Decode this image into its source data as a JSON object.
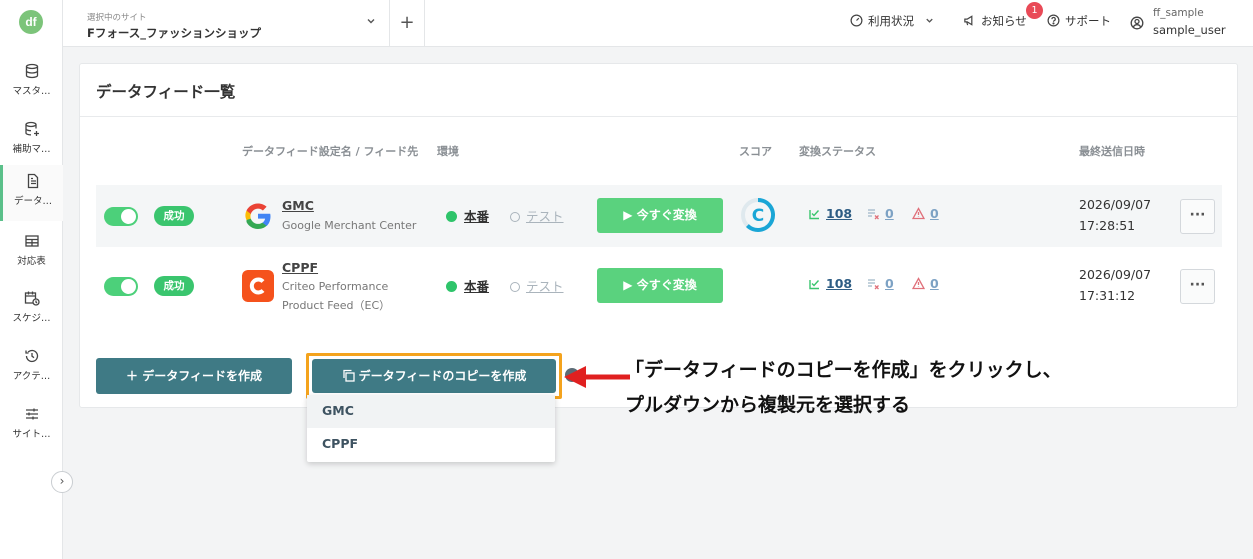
{
  "sidebar": {
    "logo": "df",
    "items": [
      {
        "label": "マスタ…",
        "icon": "database-icon"
      },
      {
        "label": "補助マ…",
        "icon": "database-add-icon"
      },
      {
        "label": "データ…",
        "icon": "document-icon"
      },
      {
        "label": "対応表",
        "icon": "table-icon"
      },
      {
        "label": "スケジ…",
        "icon": "calendar-clock-icon"
      },
      {
        "label": "アクテ…",
        "icon": "history-icon"
      },
      {
        "label": "サイト…",
        "icon": "sliders-icon"
      }
    ],
    "expand": "›"
  },
  "header": {
    "site_label": "選択中のサイト",
    "site_name": "Fフォース_ファッションショップ",
    "usage": "利用状況",
    "news": "お知らせ",
    "news_badge": "1",
    "support": "サポート",
    "user_id": "ff_sample",
    "user_name": "sample_user"
  },
  "main": {
    "title": "データフィード一覧",
    "columns": {
      "name": "データフィード設定名 / フィード先",
      "env": "環境",
      "score": "スコア",
      "status": "変換ステータス",
      "last_sent": "最終送信日時"
    },
    "rows": [
      {
        "enabled": true,
        "status": "成功",
        "name": "GMC",
        "dest": "Google Merchant Center",
        "env_live": "本番",
        "env_test": "テスト",
        "convert": "▶ 今すぐ変換",
        "score_label": "C",
        "ok_count": "108",
        "x_count": "0",
        "warn_count": "0",
        "sent_date": "2026/09/07",
        "sent_time": "17:28:51",
        "more": "···"
      },
      {
        "enabled": true,
        "status": "成功",
        "name": "CPPF",
        "dest": "Criteo Performance Product Feed（EC）",
        "env_live": "本番",
        "env_test": "テスト",
        "convert": "▶ 今すぐ変換",
        "ok_count": "108",
        "x_count": "0",
        "warn_count": "0",
        "sent_date": "2026/09/07",
        "sent_time": "17:31:12",
        "more": "···"
      }
    ],
    "create_button": "＋ データフィードを作成",
    "copy_button": "データフィードのコピーを作成",
    "dropdown": [
      "GMC",
      "CPPF"
    ]
  },
  "annotation": {
    "line1": "「データフィードのコピーを作成」をクリックし、",
    "line2": "プルダウンから複製元を選択する"
  },
  "colors": {
    "accent": "#3f7a85",
    "success": "#3ac56e",
    "highlight": "#f4a31d",
    "arrow": "#e02020"
  }
}
